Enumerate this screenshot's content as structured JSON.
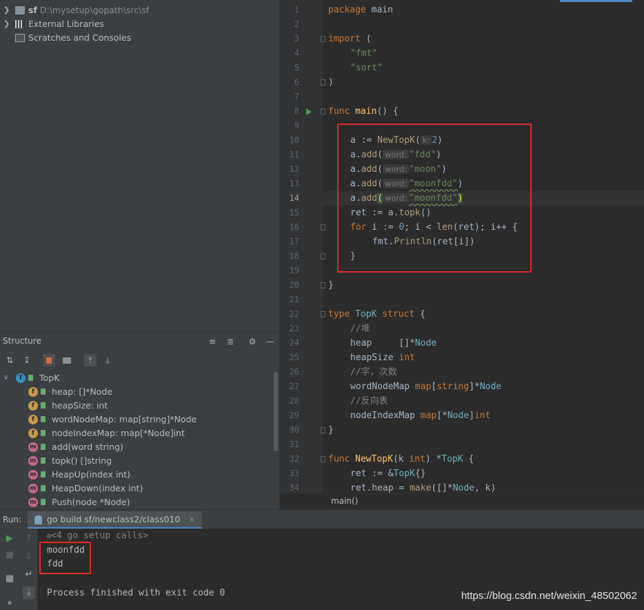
{
  "project_tree": {
    "root_name": "sf",
    "root_path": "D:\\mysetup\\gopath\\src\\sf",
    "external_libraries": "External Libraries",
    "scratches": "Scratches and Consoles"
  },
  "structure": {
    "title": "Structure",
    "root": {
      "badge": "T",
      "label": "TopK"
    },
    "items": [
      {
        "badge": "f",
        "label": "heap: []*Node"
      },
      {
        "badge": "f",
        "label": "heapSize: int"
      },
      {
        "badge": "f",
        "label": "wordNodeMap: map[string]*Node"
      },
      {
        "badge": "f",
        "label": "nodeIndexMap: map[*Node]int"
      },
      {
        "badge": "m",
        "label": "add(word string)"
      },
      {
        "badge": "m",
        "label": "topk() []string"
      },
      {
        "badge": "m",
        "label": "HeapUp(index int)"
      },
      {
        "badge": "m",
        "label": "HeapDown(index int)"
      },
      {
        "badge": "m",
        "label": "Push(node *Node)"
      }
    ]
  },
  "editor": {
    "line_numbers": [
      "1",
      "2",
      "3",
      "4",
      "5",
      "6",
      "7",
      "8",
      "9",
      "10",
      "11",
      "12",
      "13",
      "14",
      "15",
      "16",
      "17",
      "18",
      "19",
      "20",
      "21",
      "22",
      "23",
      "24",
      "25",
      "26",
      "27",
      "28",
      "29",
      "30",
      "31",
      "32",
      "33",
      "34"
    ],
    "current_line": "14",
    "code": {
      "l1_kw": "package",
      "l1_rest": " main",
      "l3_kw": "import",
      "l3_rest": " (",
      "l4": "\"fmt\"",
      "l5": "\"sort\"",
      "l6": ")",
      "l8_kw": "func",
      "l8_fn": "main",
      "l8_rest": "() {",
      "l10_a": "a := ",
      "l10_call": "NewTopK",
      "l10_p": "(",
      "l10_hint": "k:",
      "l10_num": "2",
      "l10_e": ")",
      "l11_a": "a.",
      "l11_call": "add",
      "l11_p": "(",
      "l11_hint": "word:",
      "l11_str": "\"fdd\"",
      "l11_e": ")",
      "l12_a": "a.",
      "l12_call": "add",
      "l12_p": "(",
      "l12_hint": "word:",
      "l12_str": "\"moon\"",
      "l12_e": ")",
      "l13_a": "a.",
      "l13_call": "add",
      "l13_p": "(",
      "l13_hint": "word:",
      "l13_str": "\"moonfdd\"",
      "l13_e": ")",
      "l14_a": "a.",
      "l14_call": "add",
      "l14_p": "(",
      "l14_hint": "word:",
      "l14_str": "\"moonfdd\"",
      "l14_e": ")",
      "l15_a": "ret := a.",
      "l15_call": "topk",
      "l15_e": "()",
      "l16_kw": "for",
      "l16_a": " i := ",
      "l16_num": "0",
      "l16_b": "; i < ",
      "l16_len": "len",
      "l16_c": "(ret); i++ {",
      "l17_pkg": "fmt.",
      "l17_call": "Println",
      "l17_e": "(ret[i])",
      "l18": "}",
      "l20": "}",
      "l22_kw": "type",
      "l22_name": " TopK ",
      "l22_kw2": "struct",
      "l22_e": " {",
      "l23": "//堆",
      "l24_a": "heap     []*",
      "l24_t": "Node",
      "l25_a": "heapSize ",
      "l25_t": "int",
      "l26": "//字，次数",
      "l27_a": "wordNodeMap ",
      "l27_kw": "map",
      "l27_b": "[",
      "l27_t1": "string",
      "l27_c": "]*",
      "l27_t2": "Node",
      "l28": "//反向表",
      "l29_a": "nodeIndexMap ",
      "l29_kw": "map",
      "l29_b": "[*",
      "l29_t1": "Node",
      "l29_c": "]",
      "l29_t2": "int",
      "l30": "}",
      "l32_kw": "func",
      "l32_fn": " NewTopK",
      "l32_a": "(k ",
      "l32_t": "int",
      "l32_b": ") *",
      "l32_t2": "TopK",
      "l32_c": " {",
      "l33_a": "ret := &",
      "l33_t": "TopK",
      "l33_b": "{}",
      "l34_a": "ret.heap = ",
      "l34_call": "make",
      "l34_b": "([]*",
      "l34_t": "Node",
      "l34_c": ", k)"
    },
    "breadcrumb": "main()"
  },
  "run": {
    "label": "Run:",
    "tab": "go build sf/newclass2/class010",
    "console": {
      "setup": "<4 go setup calls>",
      "out1": "moonfdd",
      "out2": "fdd",
      "finish": "Process finished with exit code 0"
    }
  },
  "watermark": "https://blog.csdn.net/weixin_48502062",
  "colors": {
    "highlight_box": "#e22a2a",
    "keyword": "#cc7832",
    "string": "#6a8759",
    "function": "#ffc66d",
    "number": "#6897bb"
  }
}
